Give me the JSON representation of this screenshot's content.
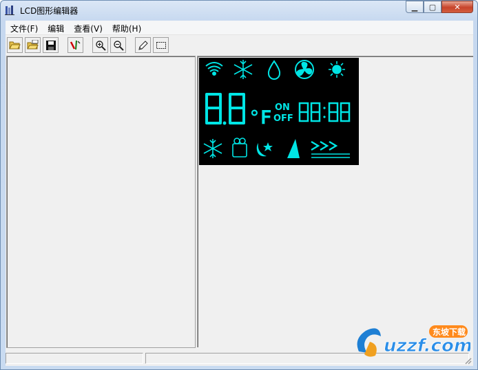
{
  "window": {
    "title": "LCD图形编辑器"
  },
  "menu": [
    "文件(F)",
    "编辑",
    "查看(V)",
    "帮助(H)"
  ],
  "toolbar": [
    "open-folder-icon",
    "open-lcd-icon",
    "save-icon",
    "tool-icon",
    "zoom-in-icon",
    "zoom-out-icon",
    "pencil-icon",
    "select-rect-icon"
  ],
  "lcd": {
    "big_digits": "8.8",
    "unit": "°F",
    "on_label": "ON",
    "off_label": "OFF",
    "clock": "88:88",
    "glow_color": "#00e5e5"
  },
  "watermark": {
    "brand": "uzzf.com",
    "tag": "东坡下载"
  }
}
